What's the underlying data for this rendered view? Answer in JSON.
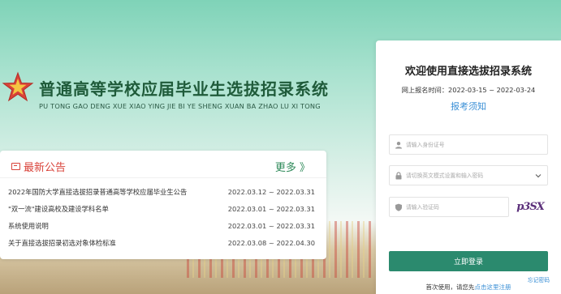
{
  "hero": {
    "title": "普通高等学校应届毕业生选拔招录系统",
    "subtitle": "PU TONG GAO DENG XUE XIAO YING JIE BI YE SHENG XUAN BA ZHAO LU XI TONG"
  },
  "notice": {
    "title": "最新公告",
    "more": "更多 》",
    "items": [
      {
        "text": "2022年国防大学直接选拔招录普通高等学校应届毕业生公告",
        "date": "2022.03.12 ~ 2022.03.31"
      },
      {
        "text": "\"双一流\"建设高校及建设学科名单",
        "date": "2022.03.01 ~ 2022.03.31"
      },
      {
        "text": "系统使用说明",
        "date": "2022.03.01 ~ 2022.03.31"
      },
      {
        "text": "关于直接选拔招录初选对象体检标准",
        "date": "2022.03.08 ~ 2022.04.30"
      }
    ]
  },
  "login": {
    "title": "欢迎使用直接选拔招录系统",
    "period": "网上报名时间：2022-03-15 ~ 2022-03-24",
    "guide": "报考须知",
    "id_placeholder": "请输入身份证号",
    "password_placeholder": "请切换英文模式设置和输入密码",
    "captcha_placeholder": "请输入验证码",
    "captcha_text": "p3SX",
    "button": "立即登录",
    "forgot": "忘记密码",
    "register_prefix": "首次使用，请您先",
    "register_link": "点击这里注册"
  },
  "colors": {
    "accent": "#2b8a6e",
    "title_green": "#1f5b3a",
    "notice_red": "#d9433a",
    "link_blue": "#3a8fd6"
  }
}
